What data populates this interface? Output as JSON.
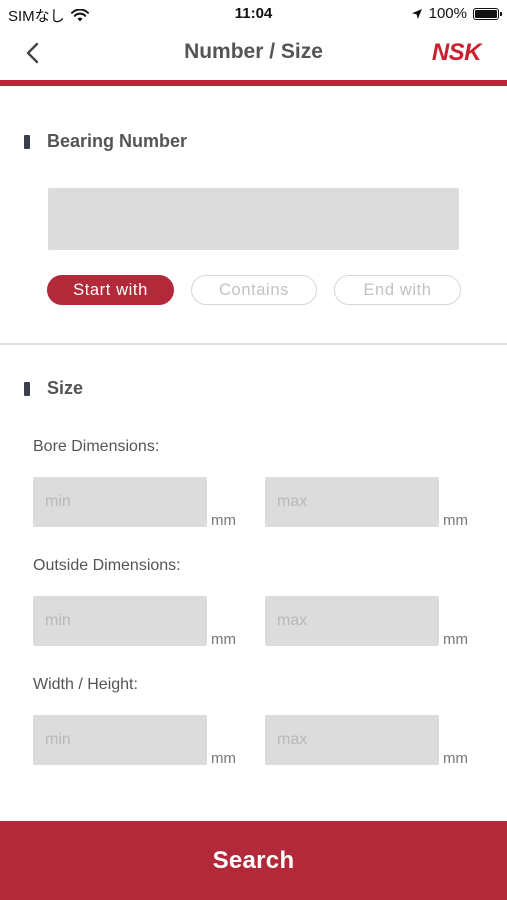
{
  "status_bar": {
    "carrier": "SIMなし",
    "time": "11:04",
    "battery": "100%",
    "icons": [
      "wifi-icon",
      "location-arrow-icon",
      "battery-icon"
    ]
  },
  "nav": {
    "back_icon": "chevron-left-icon",
    "title": "Number / Size",
    "logo": "NSK"
  },
  "bearing": {
    "title": "Bearing Number",
    "input_value": "",
    "input_placeholder": "",
    "modes": [
      {
        "label": "Start with",
        "selected": true
      },
      {
        "label": "Contains",
        "selected": false
      },
      {
        "label": "End with",
        "selected": false
      }
    ]
  },
  "size": {
    "title": "Size",
    "fields": [
      {
        "label": "Bore Dimensions:",
        "min_placeholder": "min",
        "max_placeholder": "max",
        "unit": "mm"
      },
      {
        "label": "Outside Dimensions:",
        "min_placeholder": "min",
        "max_placeholder": "max",
        "unit": "mm"
      },
      {
        "label": "Width / Height:",
        "min_placeholder": "min",
        "max_placeholder": "max",
        "unit": "mm"
      }
    ]
  },
  "search_label": "Search",
  "colors": {
    "accent": "#b22a3a",
    "logo": "#cc1f2f",
    "input_bg": "#dcdcdc",
    "section_marker": "#3a3d4a"
  }
}
